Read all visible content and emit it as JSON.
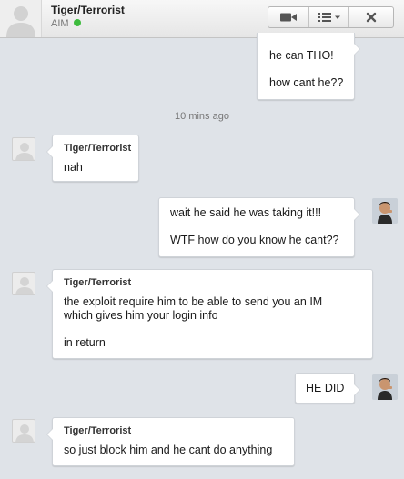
{
  "header": {
    "contact_name": "Tiger/Terrorist",
    "service": "AIM",
    "status_color": "#3dbb3d",
    "buttons": [
      {
        "name": "video-call-button",
        "icon": "video-camera-icon"
      },
      {
        "name": "list-menu-button",
        "icon": "list-icon"
      },
      {
        "name": "close-button",
        "icon": "close-icon"
      }
    ]
  },
  "timestamp": "10 mins ago",
  "messages": [
    {
      "from": "me",
      "sender": "",
      "lines": [
        "he can THO!",
        "",
        "how cant he??"
      ]
    },
    {
      "from": "them",
      "sender": "Tiger/Terrorist",
      "lines": [
        "nah"
      ]
    },
    {
      "from": "me",
      "sender": "",
      "lines": [
        "wait he said he was taking it!!!",
        "",
        "WTF how do you know he cant??"
      ]
    },
    {
      "from": "them",
      "sender": "Tiger/Terrorist",
      "lines": [
        "the exploit require him to be able to send you an IM",
        "which gives him your login info",
        "",
        "in return"
      ]
    },
    {
      "from": "me",
      "sender": "",
      "lines": [
        "HE DID"
      ]
    },
    {
      "from": "them",
      "sender": "Tiger/Terrorist",
      "lines": [
        "so just block him and he cant do anything"
      ]
    }
  ]
}
